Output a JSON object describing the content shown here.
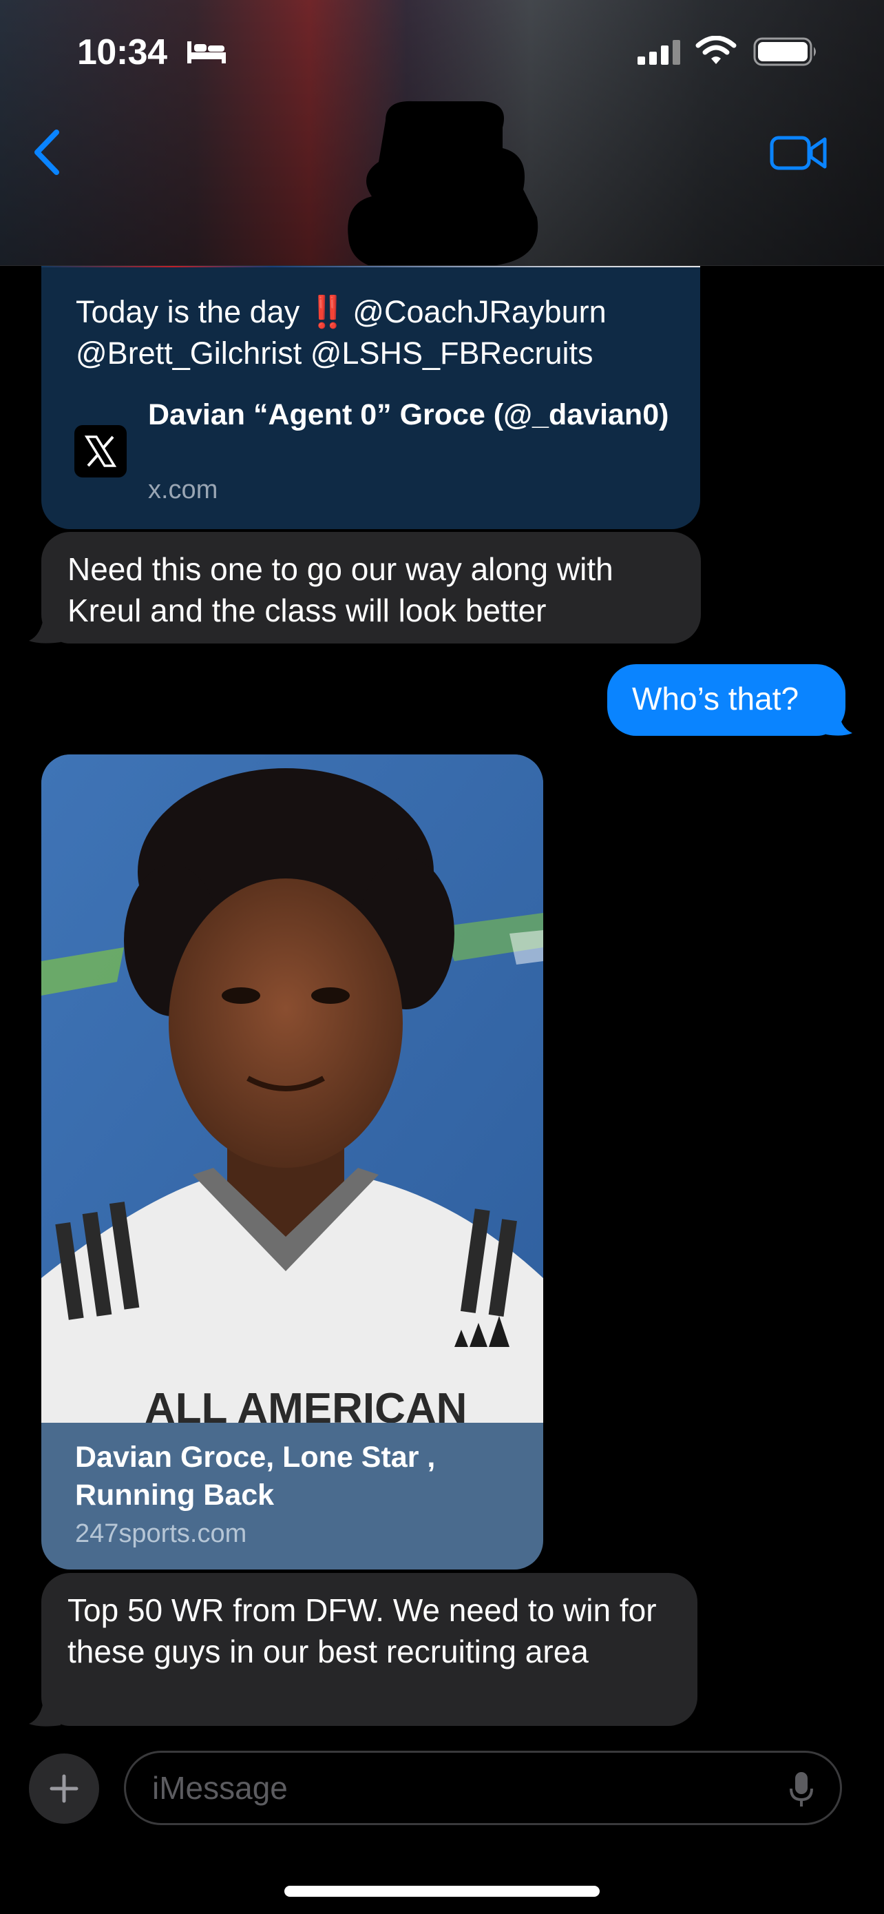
{
  "status_bar": {
    "time": "10:34"
  },
  "header": {
    "back": "back",
    "facetime": "facetime video"
  },
  "messages": [
    {
      "type": "link_preview",
      "tweet_text_pre": "Today is the day",
      "tweet_emoji": "‼️",
      "tweet_text_post": "@CoachJRayburn @Brett_Gilchrist @LSHS_FBRecruits",
      "title": "Davian “Agent 0” Groce (@_davian0)",
      "domain": "x.com"
    },
    {
      "type": "incoming",
      "text": "Need this one to go our way along with Kreul and the class will look better"
    },
    {
      "type": "outgoing",
      "text": "Who’s that?"
    },
    {
      "type": "link_preview",
      "image": "player-photo",
      "title": "Davian Groce, Lone Star , Running Back",
      "domain": "247sports.com"
    },
    {
      "type": "incoming",
      "text": "Top 50 WR from DFW. We need to win for these guys in our best recruiting area"
    }
  ],
  "input_bar": {
    "placeholder": "iMessage"
  },
  "colors": {
    "outgoing_bubble": "#0a84ff",
    "incoming_bubble": "#262628",
    "link_card_1_bg": "#0f2a45",
    "link_card_2_bg": "#4a6b8e",
    "accent": "#0a84ff"
  }
}
